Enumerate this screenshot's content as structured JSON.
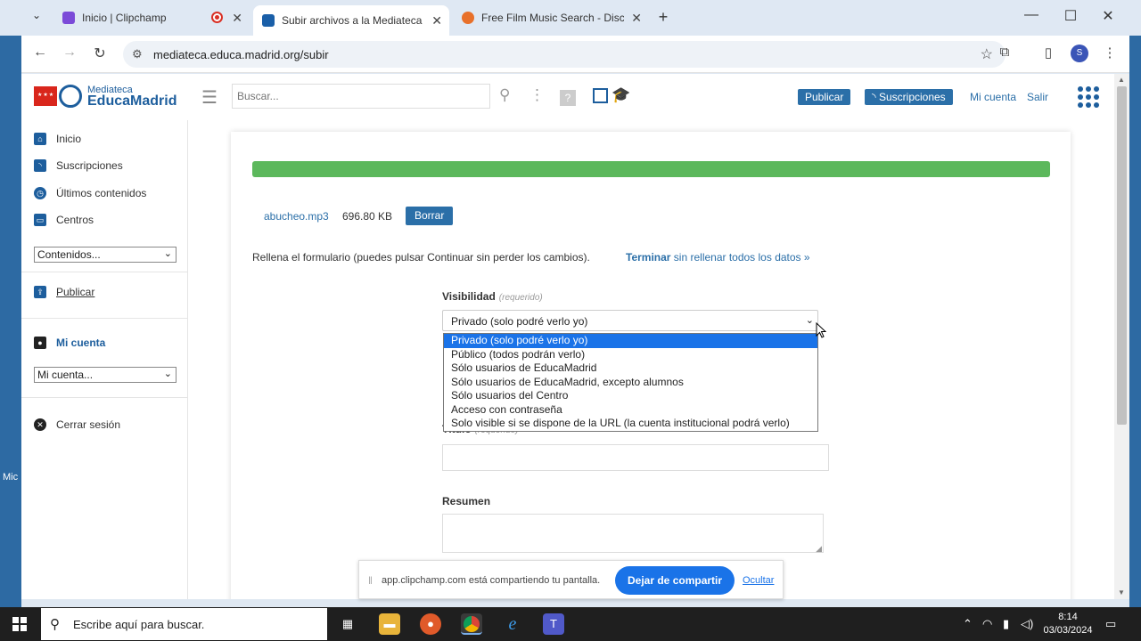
{
  "browser": {
    "tabs": [
      {
        "title": "Inicio | Clipchamp",
        "active": false,
        "favicon_color": "#7b4ad8"
      },
      {
        "title": "Subir archivos a la Mediateca | E",
        "active": true,
        "favicon_color": "#1a5fa8"
      },
      {
        "title": "Free Film Music Search - Discov",
        "active": false,
        "favicon_color": "#e8702a"
      }
    ],
    "new_tab": "+",
    "url": "mediateca.educa.madrid.org/subir",
    "profile_initial": "S"
  },
  "header": {
    "logo_sub": "Mediateca",
    "logo_main": "EducaMadrid",
    "search_placeholder": "Buscar...",
    "publicar": "Publicar",
    "suscripciones": "Suscripciones",
    "mi_cuenta": "Mi cuenta",
    "salir": "Salir"
  },
  "sidebar": {
    "items": [
      {
        "label": "Inicio"
      },
      {
        "label": "Suscripciones"
      },
      {
        "label": "Últimos contenidos"
      },
      {
        "label": "Centros"
      }
    ],
    "contenidos_select": "Contenidos...",
    "publicar": "Publicar",
    "mi_cuenta_title": "Mi cuenta",
    "mi_cuenta_select": "Mi cuenta...",
    "cerrar_sesion": "Cerrar sesión"
  },
  "upload": {
    "progress": 1.0,
    "file_name": "abucheo.mp3",
    "file_size": "696.80 KB",
    "borrar": "Borrar",
    "instructions": "Rellena el formulario (puedes pulsar Continuar sin perder los cambios).",
    "terminar_bold": "Terminar",
    "terminar_rest": " sin rellenar todos los datos »"
  },
  "form": {
    "visibilidad_label": "Visibilidad",
    "required": "(requerido)",
    "visibilidad_value": "Privado (solo podré verlo yo)",
    "visibilidad_options": [
      "Privado (solo podré verlo yo)",
      "Público (todos podrán verlo)",
      "Sólo usuarios de EducaMadrid",
      "Sólo usuarios de EducaMadrid, excepto alumnos",
      "Sólo usuarios del Centro",
      "Acceso con contraseña",
      "Solo visible si se dispone de la URL (la cuenta institucional podrá verlo)"
    ],
    "titulo_label": "Título",
    "resumen_label": "Resumen"
  },
  "share_bar": {
    "message": "app.clipchamp.com está compartiendo tu pantalla.",
    "stop": "Dejar de compartir",
    "hide": "Ocultar"
  },
  "desktop": {
    "left_label": "Mic"
  },
  "taskbar": {
    "search_placeholder": "Escribe aquí para buscar.",
    "time": "8:14",
    "date": "03/03/2024"
  },
  "colors": {
    "brand_blue": "#1d5e9d",
    "button_blue": "#2b6fa8",
    "progress_green": "#5cb85c",
    "select_highlight": "#1a73e8"
  }
}
